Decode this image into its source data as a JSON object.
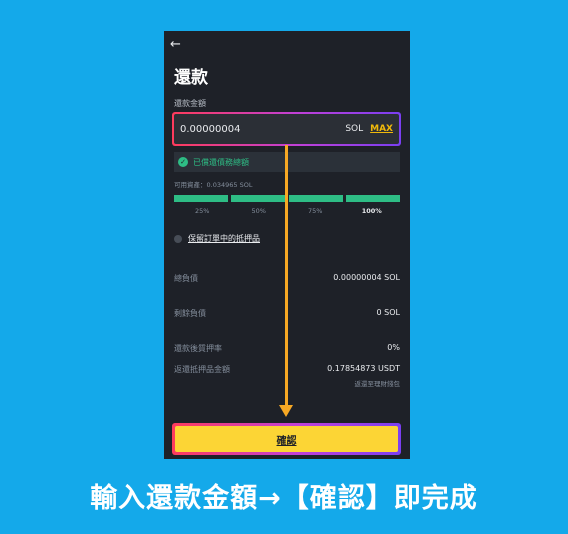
{
  "header": {
    "back_icon": "arrow-left-icon",
    "title": "還款"
  },
  "repay_amount": {
    "label": "還款金額",
    "value": "0.00000004",
    "unit": "SOL",
    "max_label": "MAX"
  },
  "repay_all": {
    "icon": "check-circle-icon",
    "label": "已償還債務總額"
  },
  "available": "可用資產：0.034965 SOL",
  "percent_options": [
    "25%",
    "50%",
    "75%",
    "100%"
  ],
  "keep_collateral": {
    "label": "保留訂單中的抵押品"
  },
  "summary": {
    "total_debt": {
      "label": "總負債",
      "value": "0.00000004 SOL"
    },
    "remaining_debt": {
      "label": "剩餘負債",
      "value": "0 SOL"
    },
    "ltv_after": {
      "label": "還款後質押率",
      "value": "0%"
    },
    "collateral_return": {
      "label": "返還抵押品金額",
      "value": "0.17854873 USDT"
    },
    "return_note": "返還至理財錢包"
  },
  "confirm_label": "確認",
  "caption": "輸入還款金額→【確認】即完成",
  "colors": {
    "background": "#14a9ea",
    "accent": "#fcd535",
    "success": "#2ebd85",
    "highlight_gradient_start": "#ff3b5c",
    "highlight_gradient_end": "#7a3ff2",
    "guide_arrow": "#f7a824"
  }
}
